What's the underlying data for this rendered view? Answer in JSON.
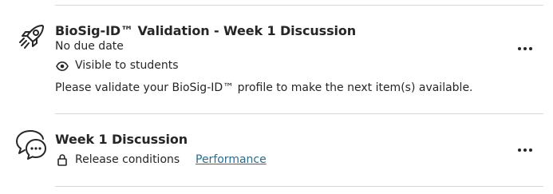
{
  "items": [
    {
      "icon": "rocket-icon",
      "title": "BioSig-ID™ Validation - Week 1 Discussion",
      "due": "No due date",
      "visibility": "Visible to students",
      "description": "Please validate your BioSig-ID™ profile to make the next item(s) available."
    },
    {
      "icon": "discussion-bubbles-icon",
      "title": "Week 1 Discussion",
      "release": "Release conditions",
      "link": "Performance"
    }
  ],
  "colors": {
    "text": "#262626",
    "divider": "#d7d7d7",
    "link": "#2a6c8c"
  }
}
